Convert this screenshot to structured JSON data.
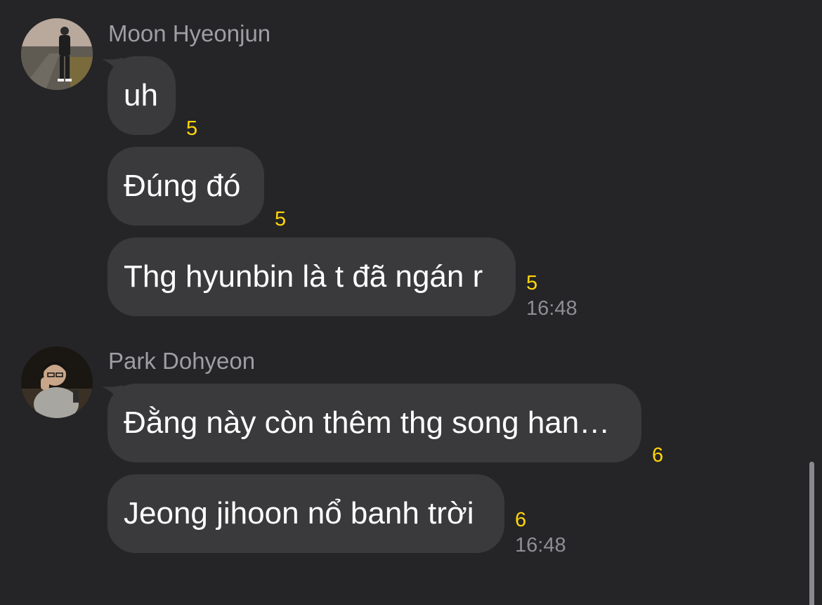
{
  "groups": [
    {
      "sender": "Moon Hyeonjun",
      "messages": [
        {
          "text": "uh",
          "unread": "5"
        },
        {
          "text": "Đúng đó",
          "unread": "5"
        },
        {
          "text": "Thg hyunbin là t đã ngán r",
          "unread": "5"
        }
      ],
      "time": "16:48"
    },
    {
      "sender": "Park Dohyeon",
      "messages": [
        {
          "text": "Đằng này còn thêm thg song han…",
          "unread": "6"
        },
        {
          "text": "Jeong jihoon nổ banh trời",
          "unread": "6"
        }
      ],
      "time": "16:48"
    }
  ],
  "colors": {
    "background": "#252527",
    "bubble": "#3a3a3c",
    "unread_count": "#ffd60a",
    "sender_name": "#9e9ea3",
    "timestamp": "#8e8e93"
  }
}
